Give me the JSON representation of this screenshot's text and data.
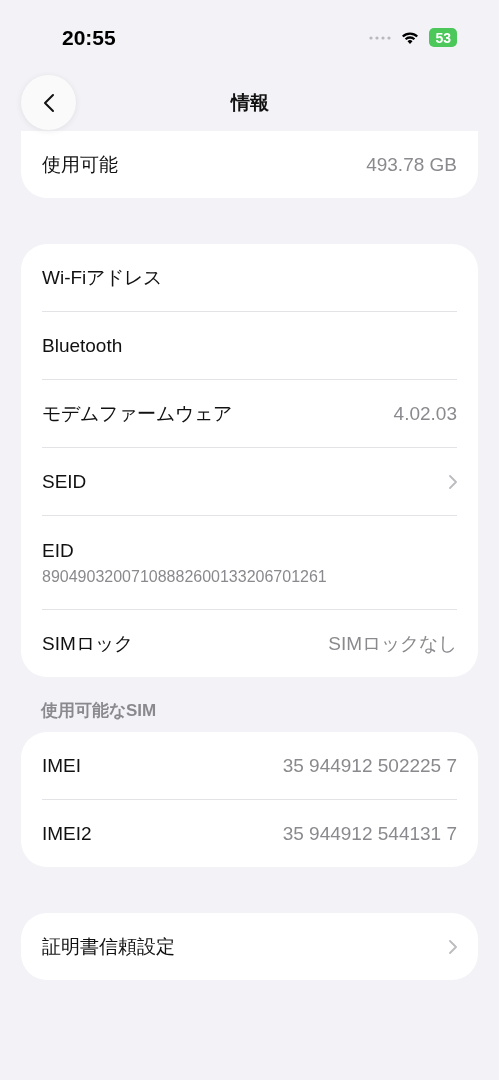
{
  "status_bar": {
    "time": "20:55",
    "battery": "53"
  },
  "nav": {
    "title": "情報"
  },
  "sections": [
    {
      "rows": [
        {
          "kind": "value",
          "label": "使用可能",
          "value": "493.78 GB"
        }
      ]
    },
    {
      "rows": [
        {
          "kind": "plain",
          "label": "Wi-Fiアドレス"
        },
        {
          "kind": "plain",
          "label": "Bluetooth"
        },
        {
          "kind": "value",
          "label": "モデムファームウェア",
          "value": "4.02.03"
        },
        {
          "kind": "chevron",
          "label": "SEID"
        },
        {
          "kind": "stacked",
          "label": "EID",
          "value": "89049032007108882600133206701261"
        },
        {
          "kind": "value",
          "label": "SIMロック",
          "value": "SIMロックなし"
        }
      ]
    },
    {
      "header": "使用可能なSIM",
      "rows": [
        {
          "kind": "value",
          "label": "IMEI",
          "value": "35 944912 502225 7"
        },
        {
          "kind": "value",
          "label": "IMEI2",
          "value": "35 944912 544131 7"
        }
      ]
    },
    {
      "rows": [
        {
          "kind": "chevron",
          "label": "証明書信頼設定"
        }
      ]
    }
  ]
}
